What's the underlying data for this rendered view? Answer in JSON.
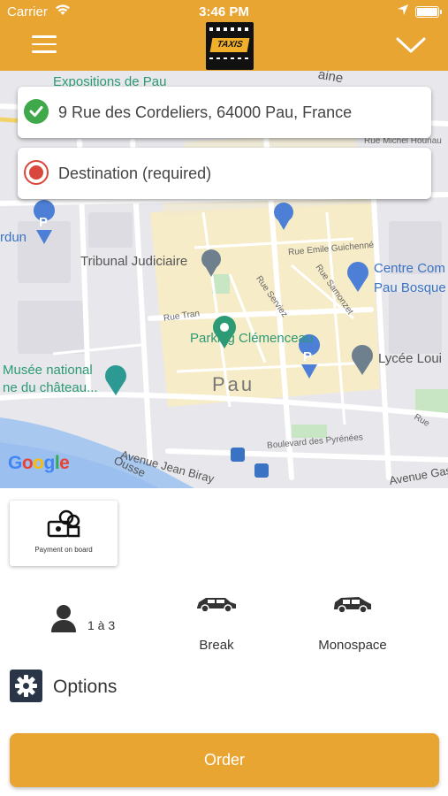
{
  "status_bar": {
    "carrier": "Carrier",
    "time": "3:46 PM"
  },
  "header": {
    "logo_text": "TAXIS PAU"
  },
  "colors": {
    "brand": "#e8a532",
    "pickup": "#3ea84a",
    "destination": "#d9463b",
    "gear_bg": "#2a3647"
  },
  "pickup": {
    "value": "9 Rue des Cordeliers, 64000 Pau, France"
  },
  "destination": {
    "placeholder": "Destination (required)"
  },
  "map": {
    "labels": {
      "expositions": "Expositions de Pau",
      "aine": "aine",
      "rue_michel": "Rue Michel Hounau",
      "rdun": "rdun",
      "tribunal": "Tribunal Judiciaire",
      "rue_emile": "Rue Emile Guichenné",
      "centre_com": "Centre Com",
      "pau_bosque": "Pau Bosque",
      "rue_tran": "Rue Tran",
      "rue_serviez": "Rue Serviez",
      "rue_samonzet": "Rue Samonzet",
      "parking": "Parking Clémenceau",
      "musee_1": "Musée national",
      "musee_2": "ne du château...",
      "lycee": "Lycée Loui",
      "pau": "Pau",
      "boulevard": "Boulevard des Pyrénées",
      "avenue_jean": "Avenue Jean Biray",
      "ousse": "Ousse",
      "avenue_gas": "Avenue Gas",
      "rue_right": "Rue"
    },
    "google": "Google"
  },
  "payment": {
    "label": "Payment on board",
    "icon": "cash-on-board-icon"
  },
  "passengers": {
    "label": "1 à 3",
    "icon": "person-icon"
  },
  "vehicles": [
    {
      "label": "Break",
      "icon": "car-icon"
    },
    {
      "label": "Monospace",
      "icon": "car-icon"
    }
  ],
  "options": {
    "label": "Options",
    "icon": "gear-icon"
  },
  "order": {
    "label": "Order"
  }
}
